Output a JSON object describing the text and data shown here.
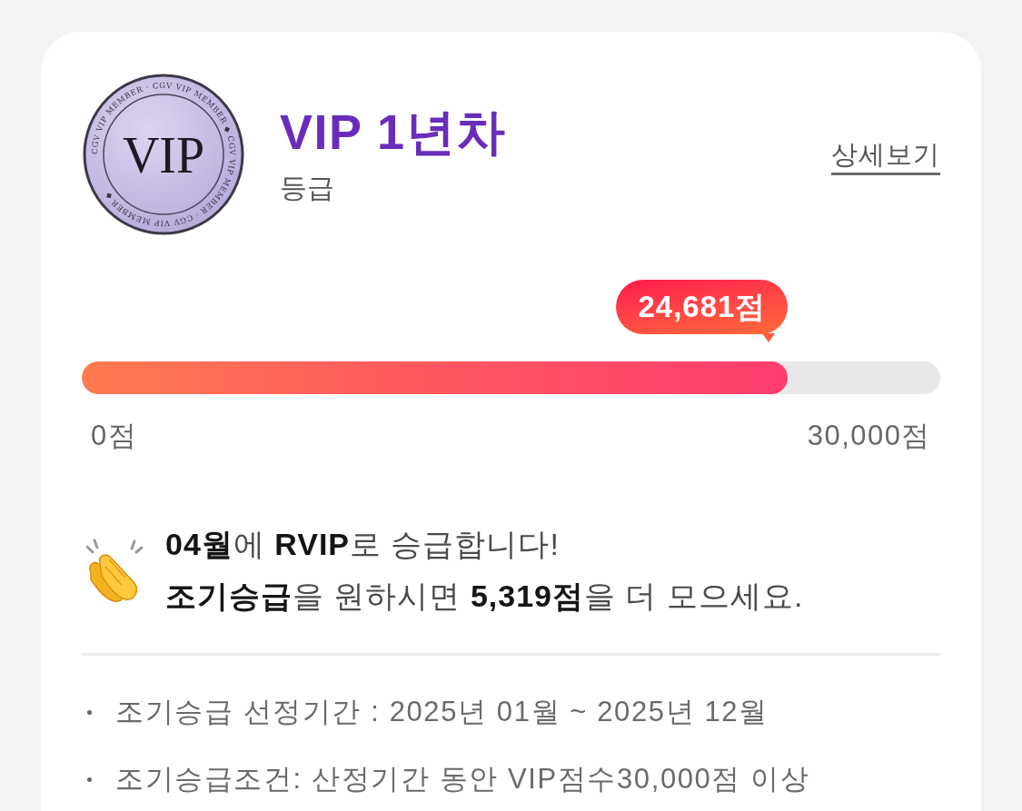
{
  "profile": {
    "badge": {
      "label": "VIP",
      "ring_text": "CGV VIP MEMBER · CGV VIP MEMBER ◆ CGV VIP MEMBER · CGV VIP MEMBER ◆"
    },
    "title": "VIP 1년차",
    "subtitle": "등급",
    "details_link": "상세보기"
  },
  "progress": {
    "score": "24,681점",
    "level": 0.8227,
    "min_label": "0점",
    "max_label": "30,000점"
  },
  "message": {
    "lines": [
      "**04월**에 **RVIP**로 승급합니다!",
      "**조기승급**을 원하시면 **5,319점**을 더 모으세요."
    ]
  },
  "notes": [
    "조기승급 선정기간 : 2025년 01월 ~ 2025년 12월",
    "조기승급조건: 산정기간 동안 VIP점수30,000점 이상"
  ]
}
